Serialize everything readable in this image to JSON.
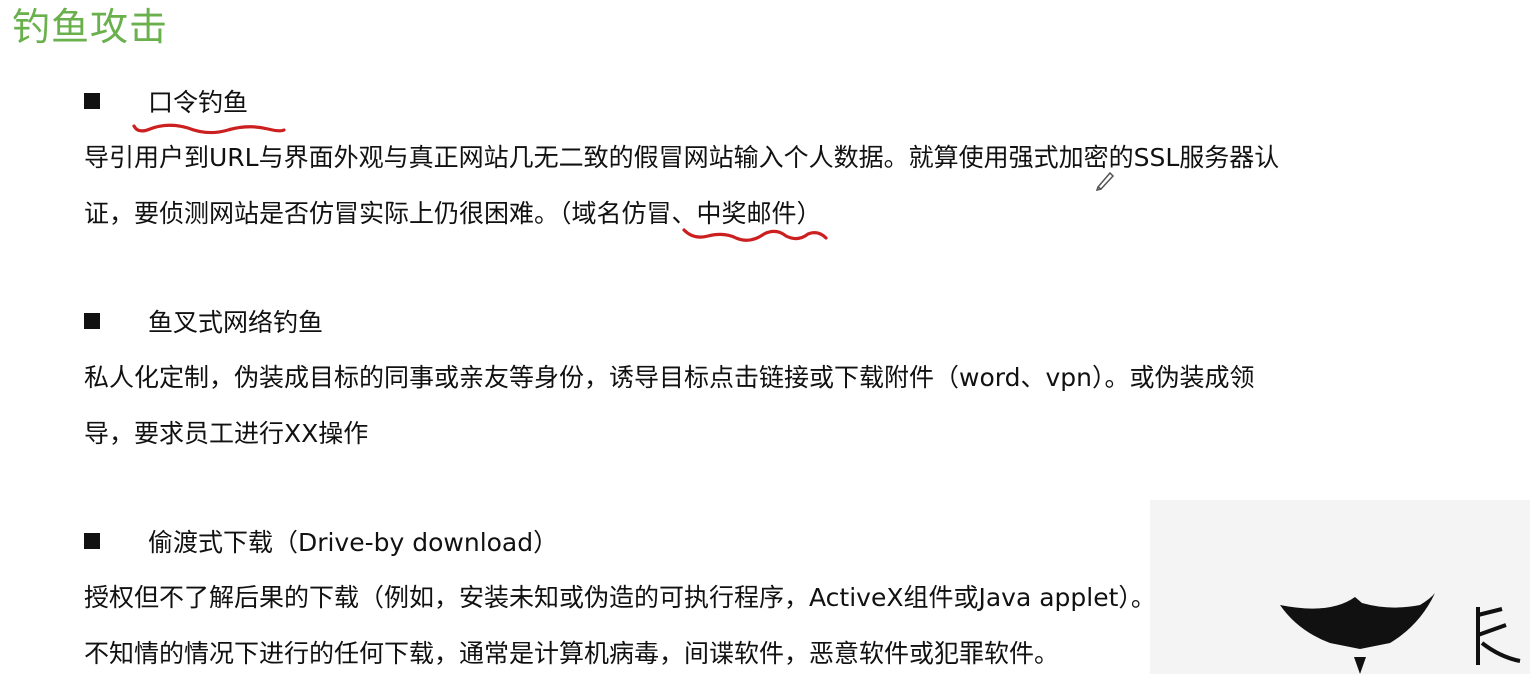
{
  "title": "钓鱼攻击",
  "sections": [
    {
      "heading": "口令钓鱼",
      "lines": [
        "导引用户到URL与界面外观与真正网站几无二致的假冒网站输入个人数据。就算使用强式加密的SSL服务器认",
        "证，要侦测网站是否仿冒实际上仍很困难。（域名仿冒、中奖邮件）"
      ]
    },
    {
      "heading": "鱼叉式网络钓鱼",
      "lines": [
        "私人化定制，伪装成目标的同事或亲友等身份，诱导目标点击链接或下载附件（word、vpn）。或伪装成领",
        "导，要求员工进行XX操作"
      ]
    },
    {
      "heading": "偷渡式下载（Drive-by download）",
      "lines": [
        "授权但不了解后果的下载（例如，安装未知或伪造的可执行程序，ActiveX组件或Java applet）。",
        "不知情的情况下进行的任何下载，通常是计算机病毒，间谍软件，恶意软件或犯罪软件。"
      ]
    }
  ],
  "annotation_color": "#cc1f1f",
  "title_color": "#6ab04c",
  "icons": [
    "bullet-square-icon",
    "pen-cursor-icon",
    "logo-mark"
  ]
}
